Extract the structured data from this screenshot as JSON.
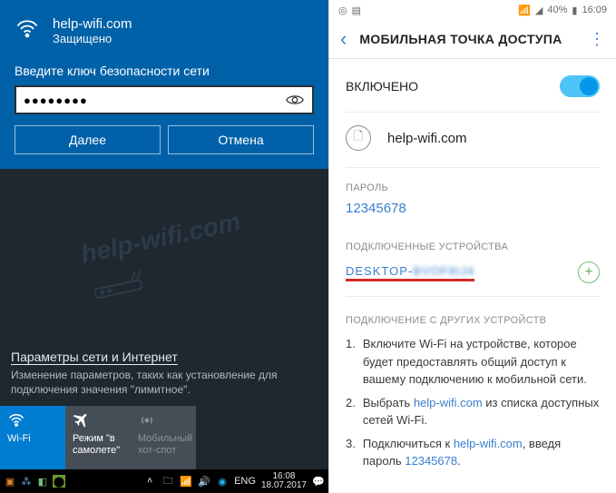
{
  "windows": {
    "wifi": {
      "ssid": "help-wifi.com",
      "status": "Защищено",
      "prompt": "Введите ключ безопасности сети",
      "password_mask": "●●●●●●●●",
      "btn_next": "Далее",
      "btn_cancel": "Отмена"
    },
    "watermark": "help-wifi.com",
    "settings": {
      "link": "Параметры сети и Интернет",
      "desc": "Изменение параметров, таких как установление для подключения значения \"лимитное\"."
    },
    "tiles": {
      "wifi": "Wi-Fi",
      "airplane": "Режим \"в самолете\"",
      "hotspot": "Мобильный хот-спот"
    },
    "taskbar": {
      "lang": "ENG",
      "time": "16:08",
      "date": "18.07.2017"
    }
  },
  "android": {
    "statusbar": {
      "battery": "40%",
      "time": "16:09"
    },
    "appbar_title": "МОБИЛЬНАЯ ТОЧКА ДОСТУПА",
    "enabled_label": "ВКЛЮЧЕНО",
    "network_name": "help-wifi.com",
    "password_label": "ПАРОЛЬ",
    "password": "12345678",
    "devices_label": "ПОДКЛЮЧЕННЫЕ УСТРОЙСТВА",
    "device_prefix": "DESKTOP-",
    "device_rest": "BVOF8IJ4",
    "other_label": "ПОДКЛЮЧЕНИЕ С ДРУГИХ УСТРОЙСТВ",
    "instructions": {
      "i1a": "Включите Wi-Fi на устройстве, которое будет предоставлять общий доступ к вашему подключению к мобильной сети.",
      "i2a": "Выбрать ",
      "i2b": "help-wifi.com",
      "i2c": " из списка доступных сетей Wi-Fi.",
      "i3a": "Подключиться к ",
      "i3b": "help-wifi.com",
      "i3c": ", введя пароль ",
      "i3d": "12345678",
      "i3e": "."
    }
  }
}
